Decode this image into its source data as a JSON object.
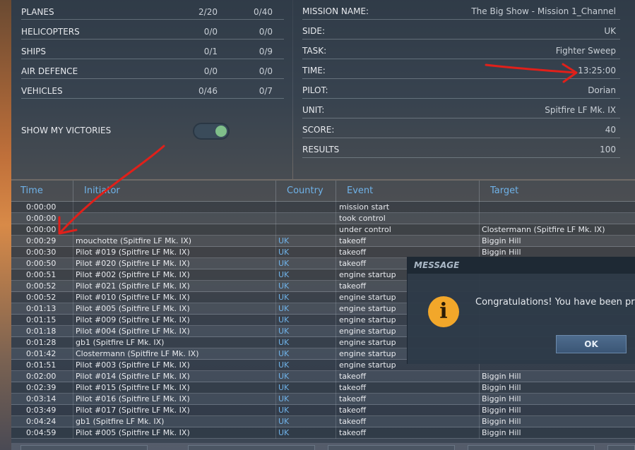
{
  "stats": [
    {
      "label": "PLANES",
      "v1": "2/20",
      "v2": "0/40"
    },
    {
      "label": "HELICOPTERS",
      "v1": "0/0",
      "v2": "0/0"
    },
    {
      "label": "SHIPS",
      "v1": "0/1",
      "v2": "0/9"
    },
    {
      "label": "AIR DEFENCE",
      "v1": "0/0",
      "v2": "0/0"
    },
    {
      "label": "VEHICLES",
      "v1": "0/46",
      "v2": "0/7"
    }
  ],
  "show_victories_label": "SHOW MY VICTORIES",
  "show_victories_on": true,
  "mission": [
    {
      "label": "MISSION NAME:",
      "value": "The Big Show - Mission 1_Channel"
    },
    {
      "label": "SIDE:",
      "value": "UK"
    },
    {
      "label": "TASK:",
      "value": "Fighter Sweep"
    },
    {
      "label": "TIME:",
      "value": "13:25:00"
    },
    {
      "label": "PILOT:",
      "value": "Dorian"
    },
    {
      "label": "UNIT:",
      "value": "Spitfire LF Mk. IX"
    },
    {
      "label": "SCORE:",
      "value": "40"
    },
    {
      "label": "RESULTS",
      "value": "100"
    }
  ],
  "table": {
    "headers": [
      "Time",
      "Initiator",
      "Country",
      "Event",
      "Target"
    ],
    "rows": [
      [
        "0:00:00",
        "",
        "",
        "mission start",
        ""
      ],
      [
        "0:00:00",
        "",
        "",
        "took control",
        ""
      ],
      [
        "0:00:00",
        "",
        "",
        "under control",
        "Clostermann (Spitfire LF Mk. IX)"
      ],
      [
        "0:00:29",
        "mouchotte (Spitfire LF Mk. IX)",
        "UK",
        "takeoff",
        "Biggin Hill"
      ],
      [
        "0:00:30",
        "Pilot #019 (Spitfire LF Mk. IX)",
        "UK",
        "takeoff",
        "Biggin Hill"
      ],
      [
        "0:00:50",
        "Pilot #020 (Spitfire LF Mk. IX)",
        "UK",
        "takeoff",
        ""
      ],
      [
        "0:00:51",
        "Pilot #002 (Spitfire LF Mk. IX)",
        "UK",
        "engine startup",
        ""
      ],
      [
        "0:00:52",
        "Pilot #021 (Spitfire LF Mk. IX)",
        "UK",
        "takeoff",
        ""
      ],
      [
        "0:00:52",
        "Pilot #010 (Spitfire LF Mk. IX)",
        "UK",
        "engine startup",
        ""
      ],
      [
        "0:01:13",
        "Pilot #005 (Spitfire LF Mk. IX)",
        "UK",
        "engine startup",
        ""
      ],
      [
        "0:01:15",
        "Pilot #009 (Spitfire LF Mk. IX)",
        "UK",
        "engine startup",
        ""
      ],
      [
        "0:01:18",
        "Pilot #004 (Spitfire LF Mk. IX)",
        "UK",
        "engine startup",
        ""
      ],
      [
        "0:01:28",
        "gb1 (Spitfire LF Mk. IX)",
        "UK",
        "engine startup",
        ""
      ],
      [
        "0:01:42",
        "Clostermann (Spitfire LF Mk. IX)",
        "UK",
        "engine startup",
        ""
      ],
      [
        "0:01:51",
        "Pilot #003 (Spitfire LF Mk. IX)",
        "UK",
        "engine startup",
        ""
      ],
      [
        "0:02:00",
        "Pilot #014 (Spitfire LF Mk. IX)",
        "UK",
        "takeoff",
        "Biggin Hill"
      ],
      [
        "0:02:39",
        "Pilot #015 (Spitfire LF Mk. IX)",
        "UK",
        "takeoff",
        "Biggin Hill"
      ],
      [
        "0:03:14",
        "Pilot #016 (Spitfire LF Mk. IX)",
        "UK",
        "takeoff",
        "Biggin Hill"
      ],
      [
        "0:03:49",
        "Pilot #017 (Spitfire LF Mk. IX)",
        "UK",
        "takeoff",
        "Biggin Hill"
      ],
      [
        "0:04:24",
        "gb1 (Spitfire LF Mk. IX)",
        "UK",
        "takeoff",
        "Biggin Hill"
      ],
      [
        "0:04:59",
        "Pilot #005 (Spitfire LF Mk. IX)",
        "UK",
        "takeoff",
        "Biggin Hill"
      ]
    ]
  },
  "dialog": {
    "title": "MESSAGE",
    "text": "Congratulations! You have been pro",
    "ok": "OK",
    "icon": "info-icon"
  },
  "colors": {
    "header_text": "#6fb2e8",
    "country_text": "#6fb2e8",
    "annotation": "#e0201a",
    "info_icon": "#f2a72a"
  }
}
